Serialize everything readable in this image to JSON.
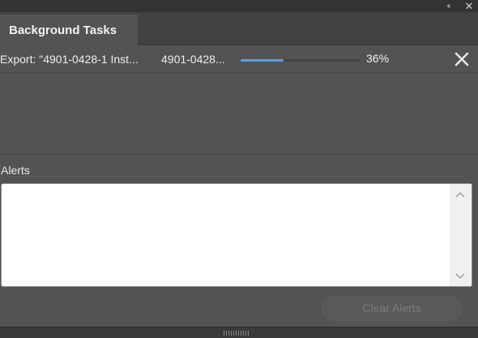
{
  "window_controls": {
    "collapse_glyph": "‹‹",
    "close_glyph": "✕"
  },
  "tabs": [
    {
      "label": "Background Tasks",
      "active": true
    }
  ],
  "tasks": [
    {
      "name": "Export: \"4901-0428-1 Inst...",
      "document": "4901-0428...",
      "progress": 0.36,
      "percent_label": "36%"
    }
  ],
  "alerts": {
    "label": "Alerts",
    "content": "",
    "clear_button_label": "Clear Alerts",
    "clear_button_enabled": false
  },
  "colors": {
    "panel_bg": "#535353",
    "progress_accent": "#4ea3f0"
  }
}
